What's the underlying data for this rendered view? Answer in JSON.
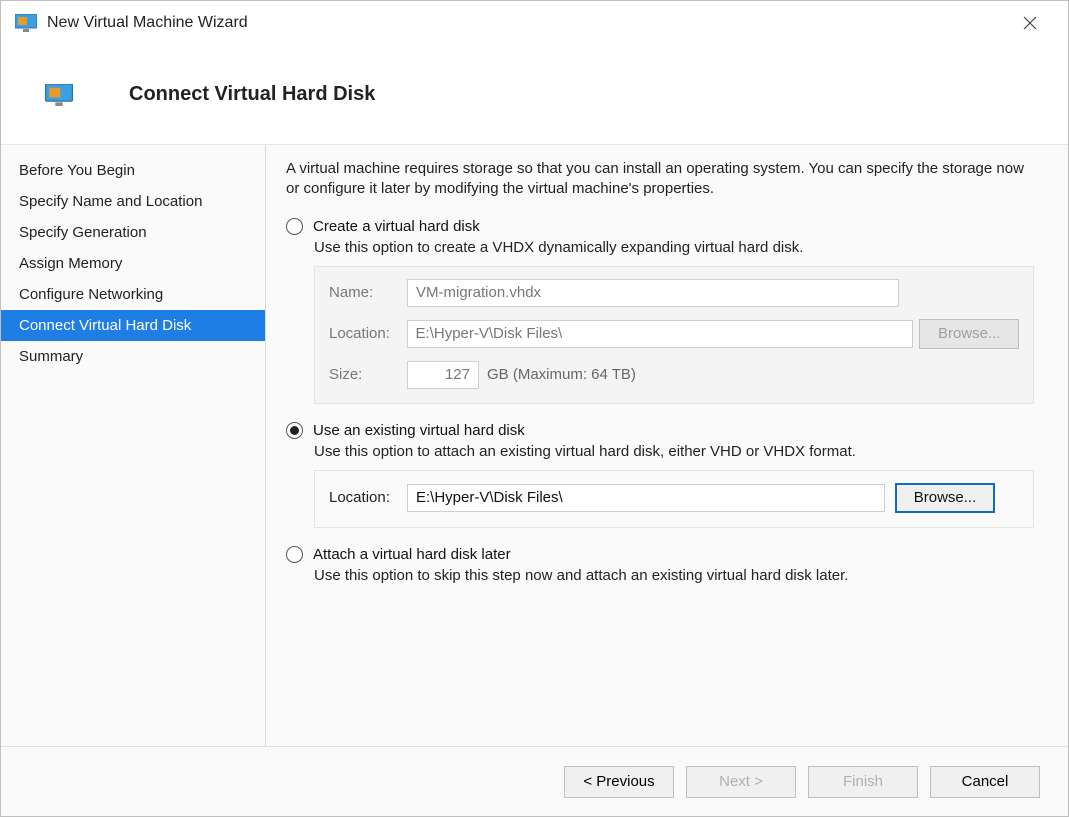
{
  "window": {
    "title": "New Virtual Machine Wizard"
  },
  "header": {
    "title": "Connect Virtual Hard Disk"
  },
  "sidebar": {
    "items": [
      {
        "label": "Before You Begin",
        "active": false
      },
      {
        "label": "Specify Name and Location",
        "active": false
      },
      {
        "label": "Specify Generation",
        "active": false
      },
      {
        "label": "Assign Memory",
        "active": false
      },
      {
        "label": "Configure Networking",
        "active": false
      },
      {
        "label": "Connect Virtual Hard Disk",
        "active": true
      },
      {
        "label": "Summary",
        "active": false
      }
    ]
  },
  "content": {
    "intro": "A virtual machine requires storage so that you can install an operating system. You can specify the storage now or configure it later by modifying the virtual machine's properties.",
    "options": {
      "create": {
        "label": "Create a virtual hard disk",
        "desc": "Use this option to create a VHDX dynamically expanding virtual hard disk.",
        "name_label": "Name:",
        "name_value": "VM-migration.vhdx",
        "location_label": "Location:",
        "location_value": "E:\\Hyper-V\\Disk Files\\",
        "browse_label": "Browse...",
        "size_label": "Size:",
        "size_value": "127",
        "size_suffix": "GB (Maximum: 64 TB)"
      },
      "existing": {
        "label": "Use an existing virtual hard disk",
        "desc": "Use this option to attach an existing virtual hard disk, either VHD or VHDX format.",
        "location_label": "Location:",
        "location_value": "E:\\Hyper-V\\Disk Files\\",
        "browse_label": "Browse..."
      },
      "later": {
        "label": "Attach a virtual hard disk later",
        "desc": "Use this option to skip this step now and attach an existing virtual hard disk later."
      }
    }
  },
  "footer": {
    "previous": "< Previous",
    "next": "Next >",
    "finish": "Finish",
    "cancel": "Cancel"
  }
}
